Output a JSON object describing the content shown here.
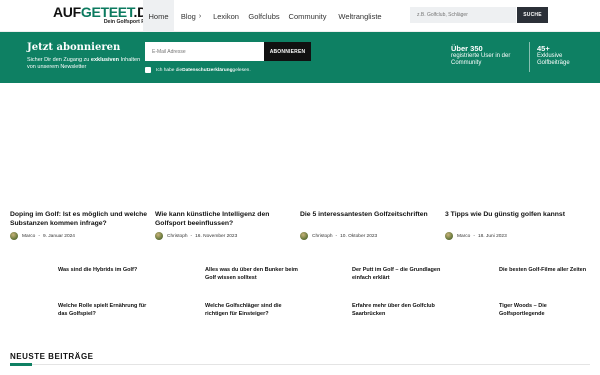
{
  "header": {
    "logo_main": "AUF",
    "logo_green": "GETEET",
    "logo_tld": ".DE",
    "logo_tagline": "Dein Golfsport Portal",
    "nav": [
      {
        "label": "Home",
        "active": true
      },
      {
        "label": "Blog",
        "active": false,
        "has_dropdown": true
      },
      {
        "label": "Lexikon",
        "active": false
      },
      {
        "label": "Golfclubs",
        "active": false
      },
      {
        "label": "Community",
        "active": false
      },
      {
        "label": "Weltrangliste",
        "active": false
      }
    ],
    "search_placeholder": "z.B. Golfclub, Schläger",
    "search_button": "SUCHE"
  },
  "banner": {
    "title": "Jetzt abonnieren",
    "subtitle_pre": "Sicher Dir den Zugang zu ",
    "subtitle_bold": "exklusiven",
    "subtitle_post": " Inhalten von unserem Newsletter",
    "email_placeholder": "E-Mail Adresse",
    "subscribe_button": "ABONNIEREN",
    "consent_pre": "Ich habe die ",
    "consent_bold": "Datenschutzerklärung",
    "consent_post": " gelesen.",
    "stat1_big": "Über 350",
    "stat1_text": "registrierte User in der Community",
    "stat2_big": "45+",
    "stat2_text": "Exklusive Golfbeiträge"
  },
  "featured": [
    {
      "title": "Doping im Golf: Ist es möglich und welche Substanzen kommen infrage?",
      "author": "Marco",
      "date": "9. Januar 2024"
    },
    {
      "title": "Wie kann künstliche Intelligenz den Golfsport beeinflussen?",
      "author": "Christoph",
      "date": "16. November 2023"
    },
    {
      "title": "Die 5 interessantesten Golfzeitschriften",
      "author": "Christoph",
      "date": "10. Oktober 2023"
    },
    {
      "title": "3 Tipps wie Du günstig golfen kannst",
      "author": "Marco",
      "date": "18. Juni 2023"
    }
  ],
  "links": [
    "Was sind die Hybrids im Golf?",
    "Alles was du über den Bunker beim Golf wissen solltest",
    "Der Putt im Golf – die Grundlagen einfach erklärt",
    "Die besten Golf-Filme aller Zeiten",
    "Welche Rolle spielt Ernährung für das Golfspiel?",
    "Welche Golfschläger sind die richtigen für Einsteiger?",
    "Erfahre mehr über den Golfclub Saarbrücken",
    "Tiger Woods – Die Golfsportlegende"
  ],
  "section_title": "NEUSTE BEITRÄGE",
  "colors": {
    "brand_green": "#0e8063",
    "dark": "#2b3038"
  }
}
